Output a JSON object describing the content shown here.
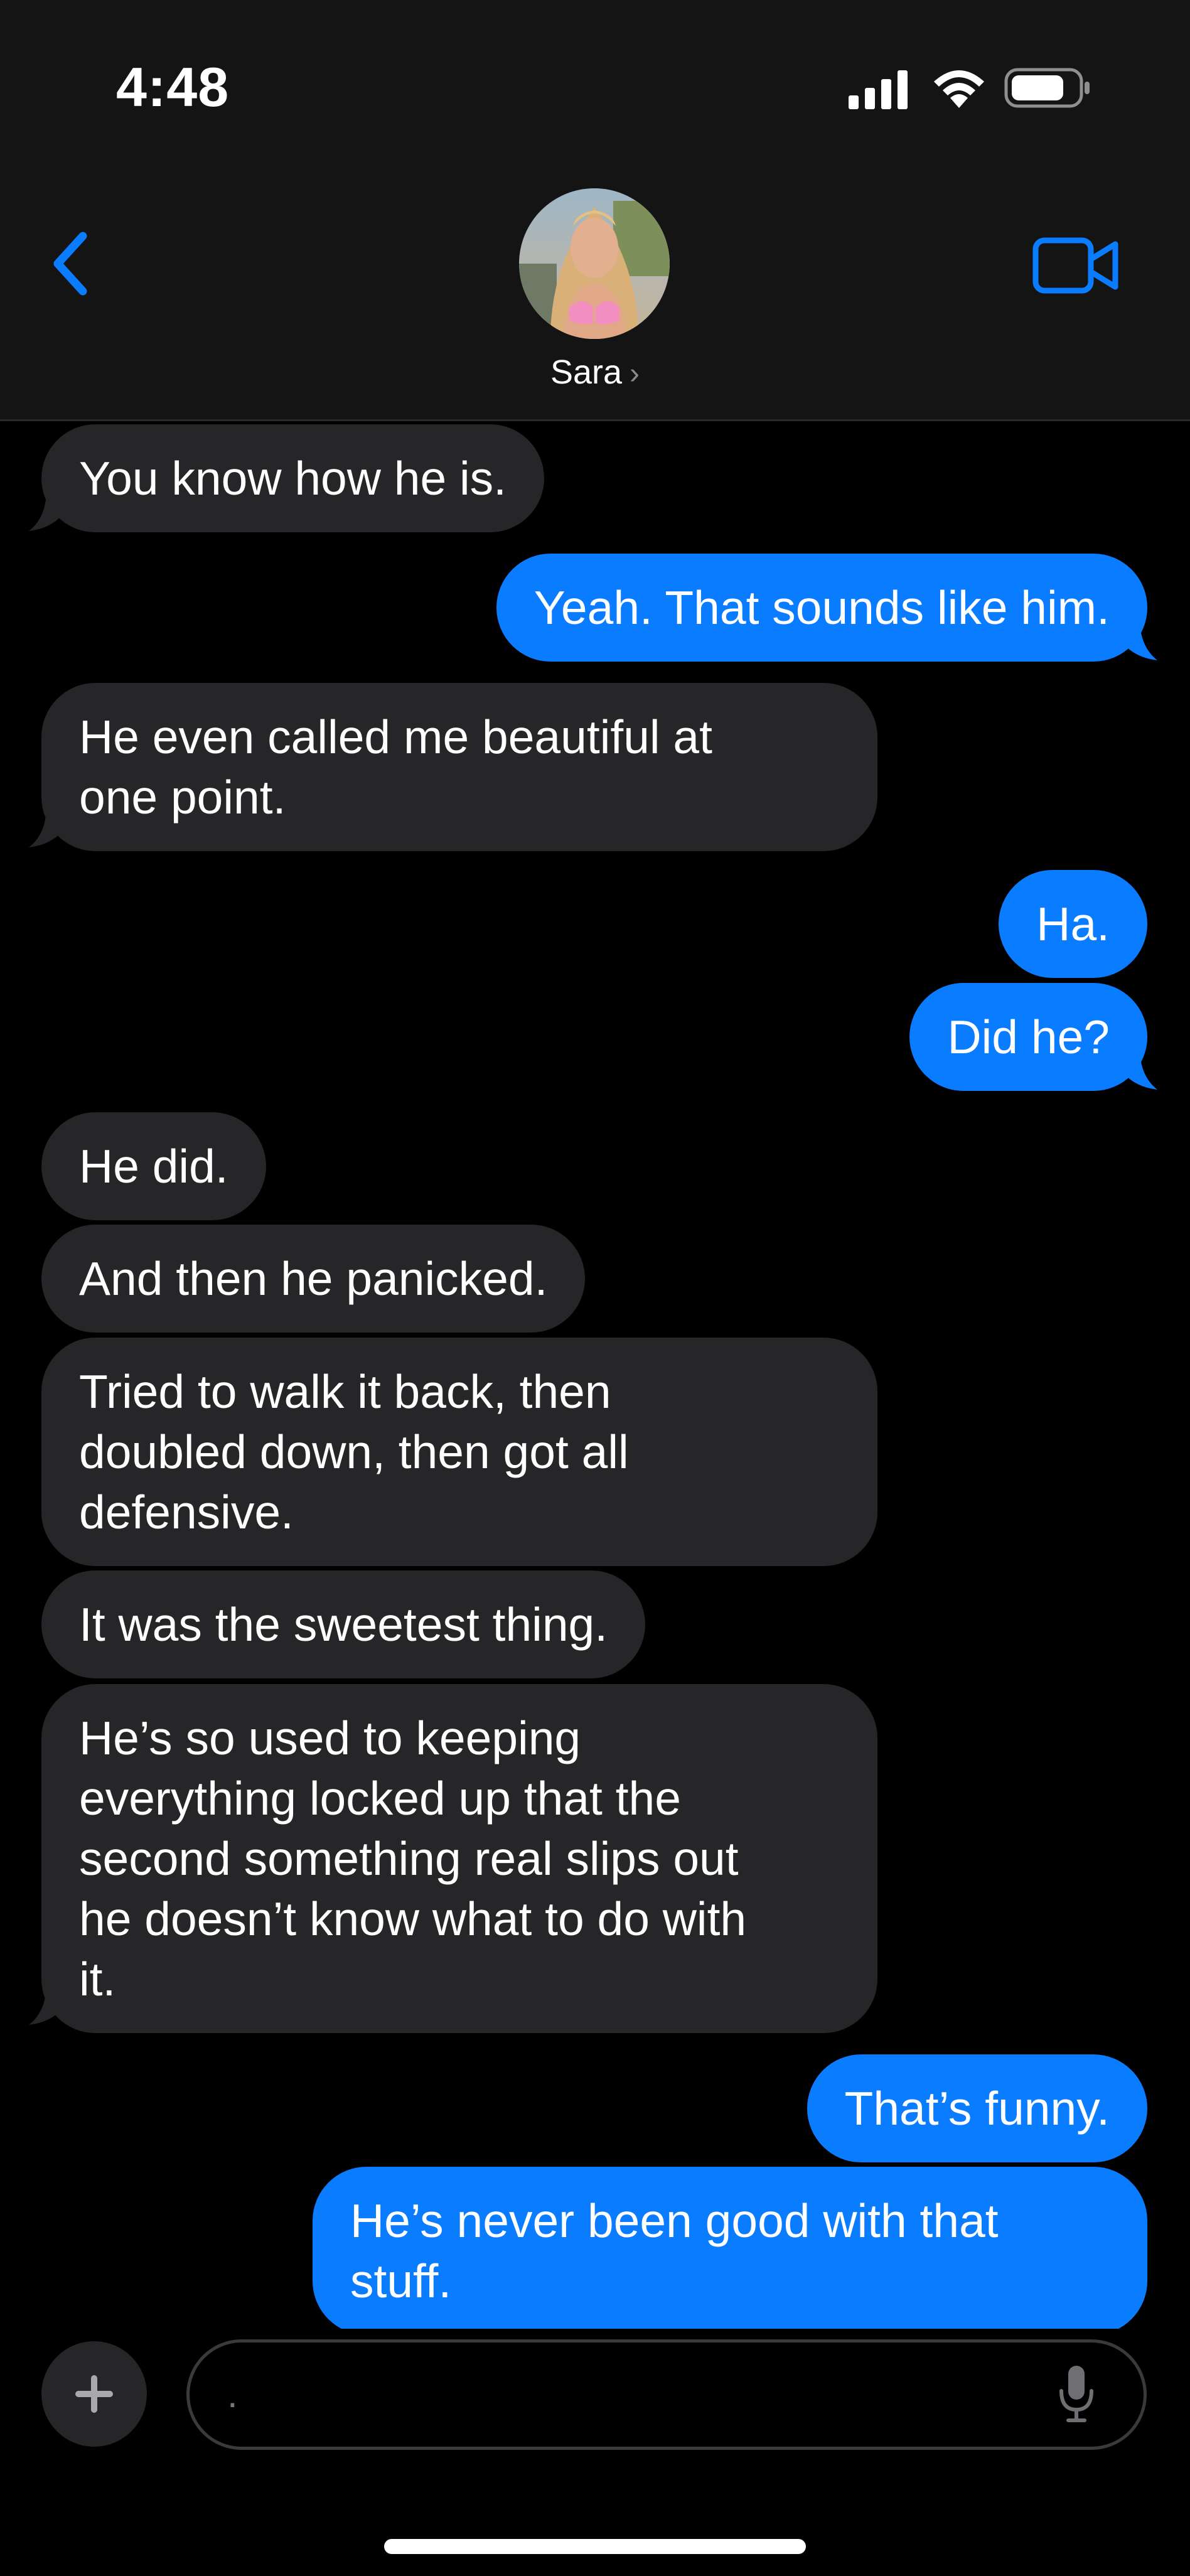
{
  "status_bar": {
    "time": "4:48"
  },
  "header": {
    "contact_name": "Sara",
    "name_chevron": "›",
    "back_icon": "chevron-left",
    "video_icon": "video-camera",
    "accent_color": "#0a7cff"
  },
  "messages": [
    {
      "direction": "in",
      "text": "You know how he is."
    },
    {
      "direction": "out",
      "text": "Yeah. That sounds like him."
    },
    {
      "direction": "in",
      "text": "He even called me beautiful at\none point."
    },
    {
      "direction": "out",
      "text": "Ha."
    },
    {
      "direction": "out",
      "text": "Did he?"
    },
    {
      "direction": "in",
      "text": "He did."
    },
    {
      "direction": "in",
      "text": "And then he panicked."
    },
    {
      "direction": "in",
      "text": "Tried to walk it back, then\ndoubled down, then got all\ndefensive."
    },
    {
      "direction": "in",
      "text": "It was the sweetest thing."
    },
    {
      "direction": "in",
      "text": "He’s so used to keeping\neverything locked up that the\nsecond something real slips out\nhe doesn’t know what to do with\nit."
    },
    {
      "direction": "out",
      "text": "That’s funny."
    },
    {
      "direction": "out",
      "text": "He’s never been good with that\nstuff."
    }
  ],
  "composer": {
    "input_value": ".",
    "plus_label": "+",
    "mic_icon": "microphone"
  },
  "colors": {
    "incoming_bubble": "#262628",
    "outgoing_bubble": "#0a7cff",
    "background": "#000000"
  }
}
